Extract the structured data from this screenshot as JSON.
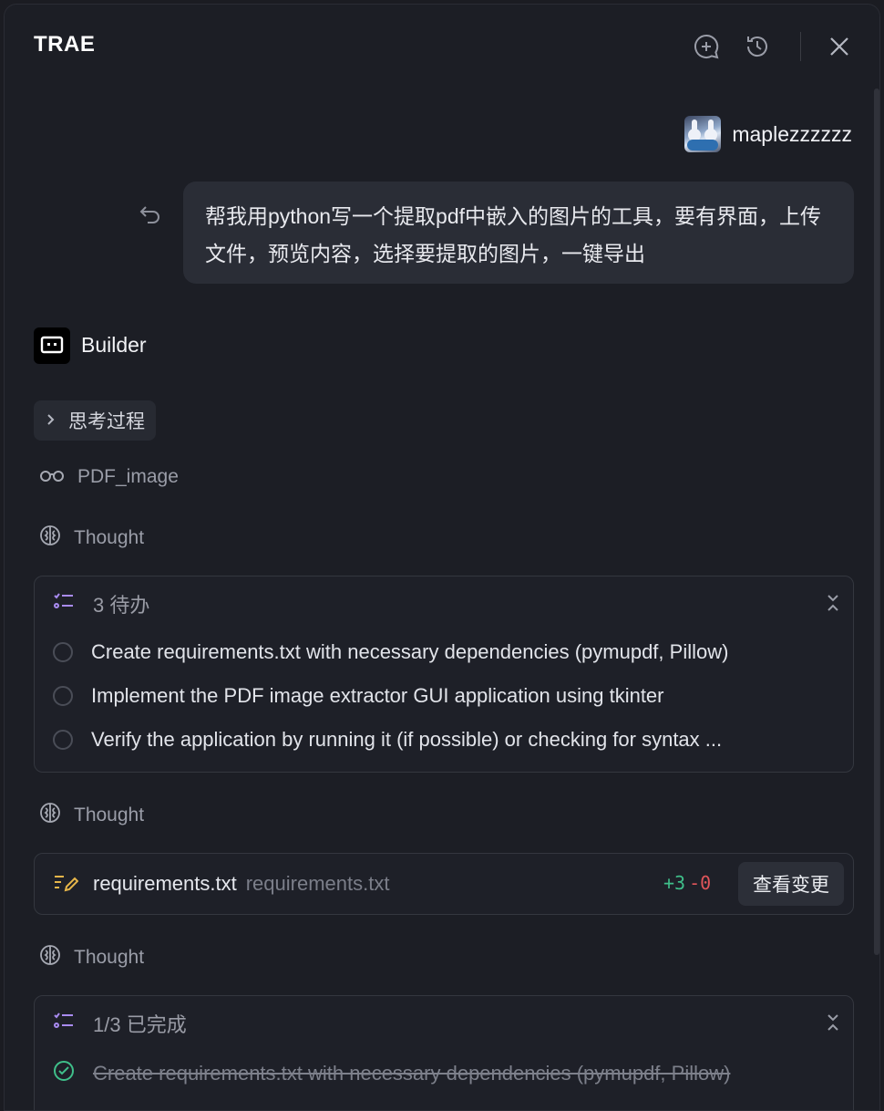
{
  "header": {
    "title": "TRAE",
    "icons": [
      "new-chat-icon",
      "history-icon",
      "close-icon"
    ]
  },
  "user": {
    "name": "maplezzzzzz",
    "message": "帮我用python写一个提取pdf中嵌入的图片的工具，要有界面，上传文件，预览内容，选择要提取的图片，一键导出"
  },
  "assistant": {
    "name": "Builder",
    "thinking_label": "思考过程",
    "project_label": "PDF_image",
    "thought_label": "Thought"
  },
  "todo1": {
    "header": "3 待办",
    "items": [
      "Create requirements.txt with necessary dependencies (pymupdf, Pillow)",
      "Implement the PDF image extractor GUI application using tkinter",
      "Verify the application by running it (if possible) or checking for syntax ..."
    ]
  },
  "file_change": {
    "name": "requirements.txt",
    "path": "requirements.txt",
    "added": "+3",
    "removed": "-0",
    "button": "查看变更"
  },
  "todo2": {
    "header": "1/3 已完成",
    "items": [
      "Create requirements.txt with necessary dependencies (pymupdf, Pillow)"
    ]
  },
  "colors": {
    "background": "#1c1e25",
    "accent_green": "#3fbf8a",
    "accent_red": "#e0555a",
    "todo_icon": "#a98bf0",
    "edit_icon": "#e7b64a"
  }
}
